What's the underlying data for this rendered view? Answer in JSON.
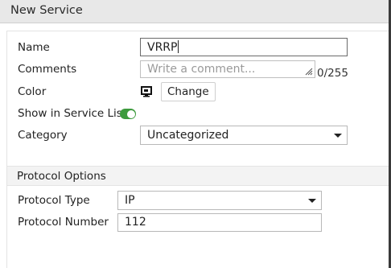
{
  "window": {
    "title": "New Service"
  },
  "form": {
    "name_label": "Name",
    "name_value": "VRRP",
    "comments_label": "Comments",
    "comments_placeholder": "Write a comment...",
    "comments_counter": "0/255",
    "color_label": "Color",
    "color_change_label": "Change",
    "show_in_list_label": "Show in Service List",
    "show_in_list_enabled": true,
    "category_label": "Category",
    "category_value": "Uncategorized"
  },
  "protocol_options": {
    "section_title": "Protocol Options",
    "type_label": "Protocol Type",
    "type_value": "IP",
    "number_label": "Protocol Number",
    "number_value": "112"
  },
  "colors": {
    "toggle_on": "#3d9a3d"
  },
  "icons": {
    "color_swatch": "monitor-color-icon",
    "dropdown": "chevron-down-icon"
  }
}
